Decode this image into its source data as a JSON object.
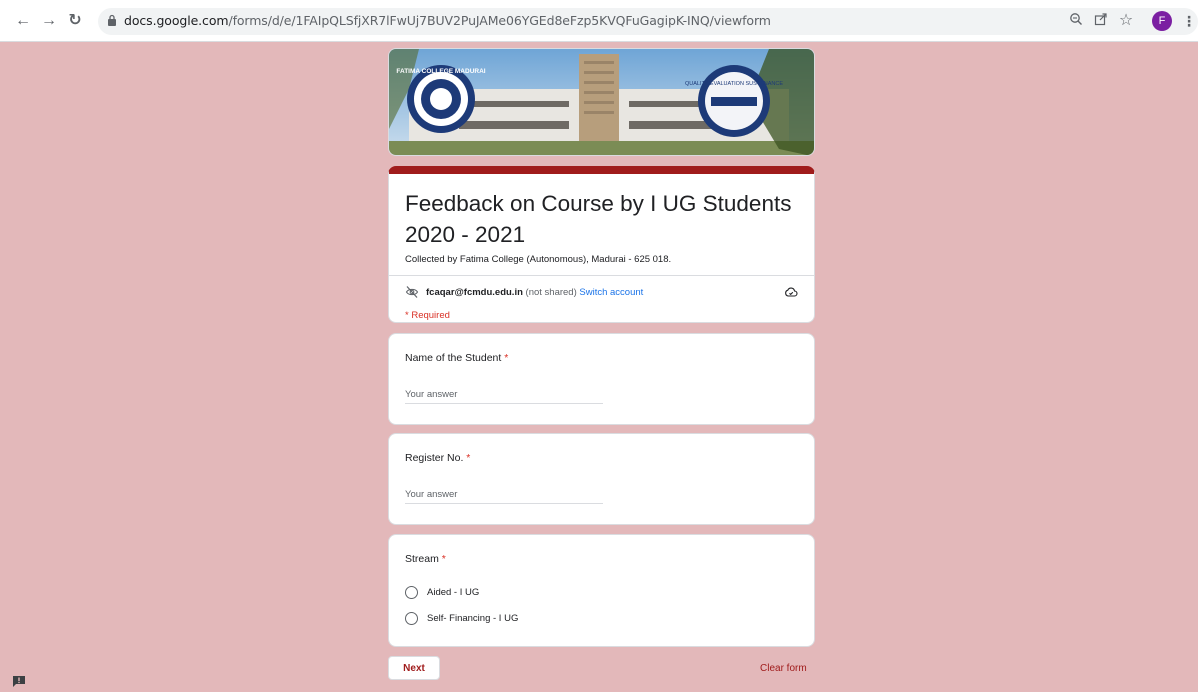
{
  "browser": {
    "url_host": "docs.google.com",
    "url_path": "/forms/d/e/1FAIpQLSfjXR7lFwUj7BUV2PuJAMe06YGEd8eFzp5KVQFuGagipK-INQ/viewform",
    "profile_initial": "F",
    "icons": [
      "back-arrow-icon",
      "forward-arrow-icon",
      "reload-icon",
      "lock-icon",
      "zoom-icon",
      "share-icon",
      "star-icon"
    ]
  },
  "banner": {
    "logo_text_left": "FATIMA COLLEGE MADURAI",
    "logo_text_right": "QUALITY EVALUATION SUSTENANCE"
  },
  "form": {
    "title": "Feedback on Course by I UG Students 2020 - 2021",
    "description": "Collected by Fatima College (Autonomous), Madurai - 625 018.",
    "account_email": "fcaqar@fcmdu.edu.in",
    "not_shared": " (not shared) ",
    "switch_account": "Switch account",
    "required_note": "* Required",
    "accent_color": "#a01c1c"
  },
  "questions": [
    {
      "label": "Name of the Student ",
      "required_mark": "*",
      "placeholder": "Your answer"
    },
    {
      "label": "Register No. ",
      "required_mark": "*",
      "placeholder": "Your answer"
    },
    {
      "label": "Stream ",
      "required_mark": "*",
      "options": [
        "Aided - I UG",
        "Self- Financing - I UG"
      ]
    }
  ],
  "actions": {
    "next_label": "Next",
    "clear_label": "Clear form"
  }
}
